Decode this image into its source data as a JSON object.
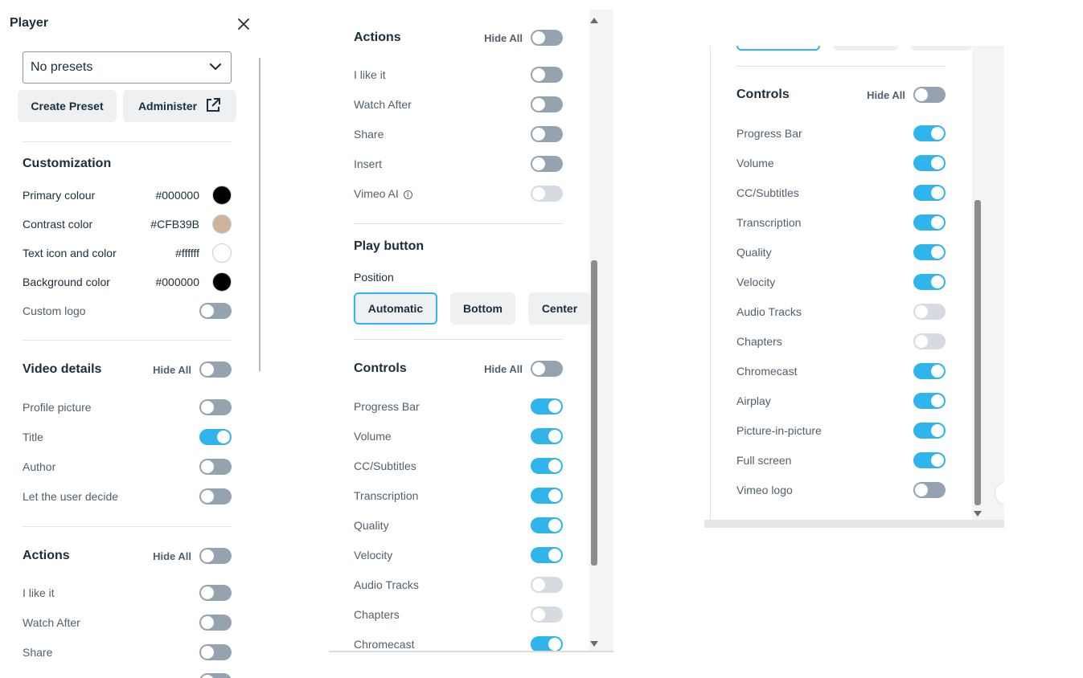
{
  "panel1": {
    "title": "Player",
    "close_icon": "close-icon",
    "preset_select": "No presets",
    "create_preset_label": "Create Preset",
    "administer_label": "Administer",
    "customization": {
      "title": "Customization",
      "colors": [
        {
          "label": "Primary colour",
          "hex": "#000000",
          "swatch": "#000000"
        },
        {
          "label": "Contrast color",
          "hex": "#CFB39B",
          "swatch": "#cfb39b"
        },
        {
          "label": "Text icon and color",
          "hex": "#ffffff",
          "swatch": "#ffffff"
        },
        {
          "label": "Background color",
          "hex": "#000000",
          "swatch": "#000000"
        }
      ],
      "custom_logo": "Custom logo"
    },
    "video_details": {
      "title": "Video details",
      "hide_all": "Hide All",
      "items": [
        "Profile picture",
        "Title",
        "Author",
        "Let the user decide"
      ]
    },
    "actions": {
      "title": "Actions",
      "hide_all": "Hide All",
      "items": [
        "I like it",
        "Watch After",
        "Share"
      ]
    }
  },
  "panel2": {
    "actions": {
      "title": "Actions",
      "hide_all": "Hide All",
      "items": [
        "I like it",
        "Watch After",
        "Share",
        "Insert",
        "Vimeo AI"
      ]
    },
    "play_button": {
      "title": "Play button",
      "position_label": "Position",
      "options": [
        "Automatic",
        "Bottom",
        "Center"
      ],
      "selected": "Automatic"
    },
    "controls": {
      "title": "Controls",
      "hide_all": "Hide All",
      "items": [
        "Progress Bar",
        "Volume",
        "CC/Subtitles",
        "Transcription",
        "Quality",
        "Velocity",
        "Audio Tracks",
        "Chapters",
        "Chromecast"
      ]
    }
  },
  "panel3": {
    "controls": {
      "title": "Controls",
      "hide_all": "Hide All",
      "items": [
        "Progress Bar",
        "Volume",
        "CC/Subtitles",
        "Transcription",
        "Quality",
        "Velocity",
        "Audio Tracks",
        "Chapters",
        "Chromecast",
        "Airplay",
        "Picture-in-picture",
        "Full screen",
        "Vimeo logo"
      ]
    }
  },
  "colors": {
    "accent": "#2fb4ec",
    "toggle_off": "#95a3b1",
    "toggle_disabled": "#d5dbe0"
  }
}
